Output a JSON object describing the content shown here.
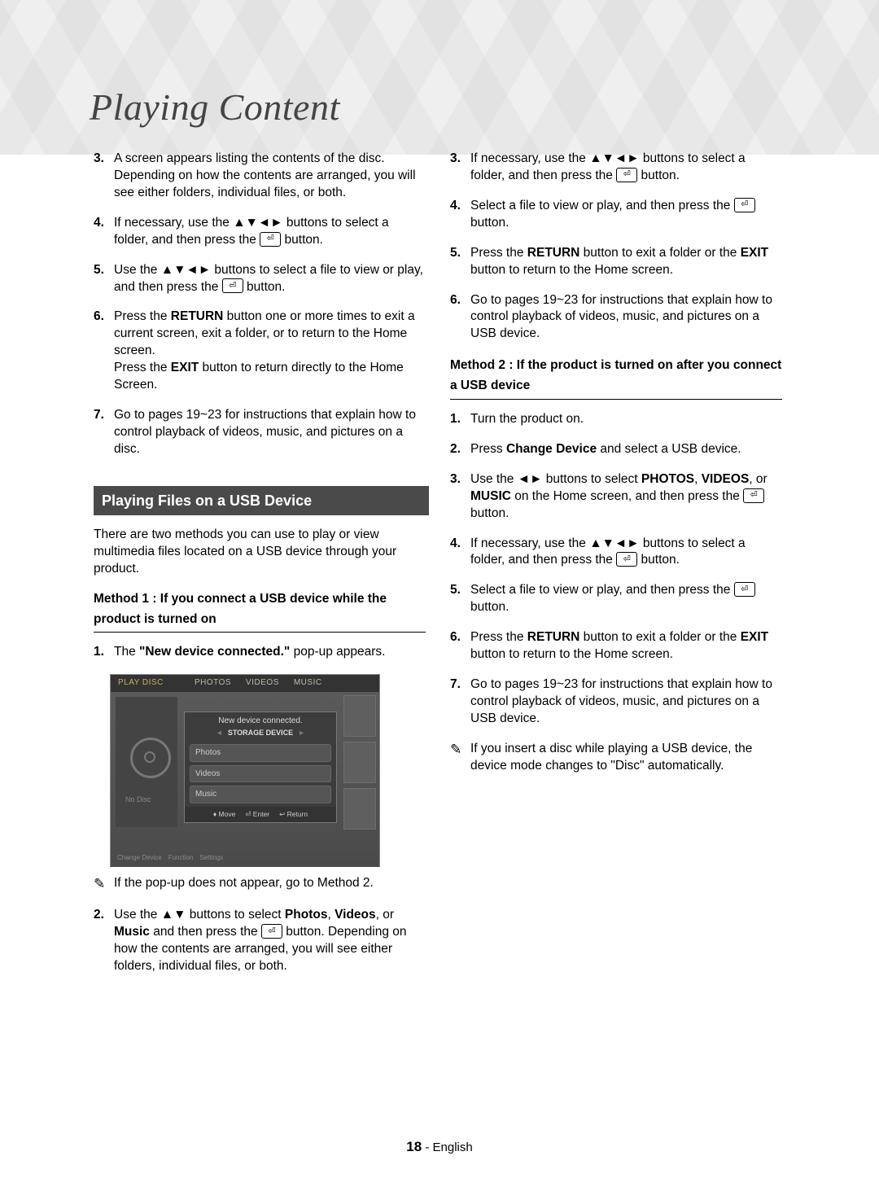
{
  "page_title": "Playing Content",
  "left_steps_a": [
    {
      "n": "3.",
      "body": "A screen appears listing the contents of the disc. Depending on how the contents are arranged, you will see either folders, individual files, or both."
    },
    {
      "n": "4.",
      "body_pre": "If necessary, use the ",
      "arrows": "▲▼◄►",
      "body_mid": " buttons to select a folder, and then press the ",
      "has_enter": true,
      "body_post": " button."
    },
    {
      "n": "5.",
      "body_pre": "Use the ",
      "arrows": "▲▼◄►",
      "body_mid": " buttons to select a file to view or play, and then press the ",
      "has_enter": true,
      "body_post": " button."
    },
    {
      "n": "6.",
      "body_pre": "Press the ",
      "bold1": "RETURN",
      "body_mid": " button one or more times to exit a current screen, exit a folder, or to return to the Home screen.",
      "br": true,
      "body_line2_pre": "Press the ",
      "bold2": "EXIT",
      "body_line2_post": " button to return directly to the Home Screen."
    },
    {
      "n": "7.",
      "body": "Go to pages 19~23 for instructions that explain how to control playback of videos, music, and pictures on a disc."
    }
  ],
  "section_bar": "Playing Files on a USB Device",
  "intro": "There are two methods you can use to play or view multimedia files located on a USB device through your product.",
  "method1_heading": "Method 1 : If you connect a USB device while the product is turned on",
  "left_m1_step1": {
    "n": "1.",
    "pre": "The ",
    "bold": "\"New device connected.\"",
    "post": " pop-up appears."
  },
  "popup": {
    "tabs": [
      "PLAY DISC",
      "PHOTOS",
      "VIDEOS",
      "MUSIC"
    ],
    "no_disc": "No Disc",
    "title": "New device connected.",
    "sub": "STORAGE DEVICE",
    "items": [
      "Photos",
      "Videos",
      "Music"
    ],
    "footer": [
      "♦ Move",
      "⏎ Enter",
      "↩ Return"
    ],
    "bottom": [
      "Change Device",
      "Function",
      "Settings"
    ]
  },
  "note1": "If the pop-up does not appear, go to Method 2.",
  "left_m1_step2": {
    "n": "2.",
    "pre": "Use the ",
    "arrows": "▲▼",
    "mid1": " buttons to select ",
    "b1": "Photos",
    "sep1": ", ",
    "b2": "Videos",
    "sep2": ", or ",
    "b3": "Music",
    "mid2": " and then press the ",
    "has_enter": true,
    "post": " button. Depending on how the contents are arranged, you will see either folders, individual files, or both."
  },
  "right_steps_a": [
    {
      "n": "3.",
      "pre": "If necessary, use the ",
      "arrows": "▲▼◄►",
      "mid": " buttons to select a folder, and then press the ",
      "has_enter": true,
      "post": " button."
    },
    {
      "n": "4.",
      "pre": "Select a file to view or play, and then press the ",
      "has_enter": true,
      "post": " button."
    },
    {
      "n": "5.",
      "pre": "Press the ",
      "b1": "RETURN",
      "mid": " button to exit a folder or the ",
      "b2": "EXIT",
      "post": " button to return to the Home screen."
    },
    {
      "n": "6.",
      "body": "Go to pages 19~23 for instructions that explain how to control playback of videos, music, and pictures on a USB device."
    }
  ],
  "method2_heading": "Method 2 : If the product is turned on after you connect a USB device",
  "right_m2_steps": [
    {
      "n": "1.",
      "body": "Turn the product on."
    },
    {
      "n": "2.",
      "pre": "Press ",
      "b1": "Change Device",
      "post": " and select a USB device."
    },
    {
      "n": "3.",
      "pre": "Use the ",
      "arrows": "◄►",
      "mid1": " buttons to select ",
      "b1": "PHOTOS",
      "sep1": ", ",
      "b2": "VIDEOS",
      "sep2": ", or ",
      "b3": "MUSIC",
      "mid2": " on the Home screen, and then press the ",
      "has_enter": true,
      "post": " button."
    },
    {
      "n": "4.",
      "pre": "If necessary, use the ",
      "arrows": "▲▼◄►",
      "mid": " buttons to select a folder, and then press the ",
      "has_enter": true,
      "post": " button."
    },
    {
      "n": "5.",
      "pre": "Select a file to view or play, and then press the ",
      "has_enter": true,
      "post": " button."
    },
    {
      "n": "6.",
      "pre": "Press the ",
      "b1": "RETURN",
      "mid": " button to exit a folder or the ",
      "b2": "EXIT",
      "post": " button to return to the Home screen."
    },
    {
      "n": "7.",
      "body": "Go to pages 19~23 for instructions that explain how to control playback of videos, music, and pictures on a USB device."
    }
  ],
  "note2": "If you insert a disc while playing a USB device, the device mode changes to \"Disc\" automatically.",
  "footer": {
    "page": "18",
    "sep": " - ",
    "lang": "English"
  },
  "enter_glyph": "⏎",
  "note_glyph": "✎"
}
